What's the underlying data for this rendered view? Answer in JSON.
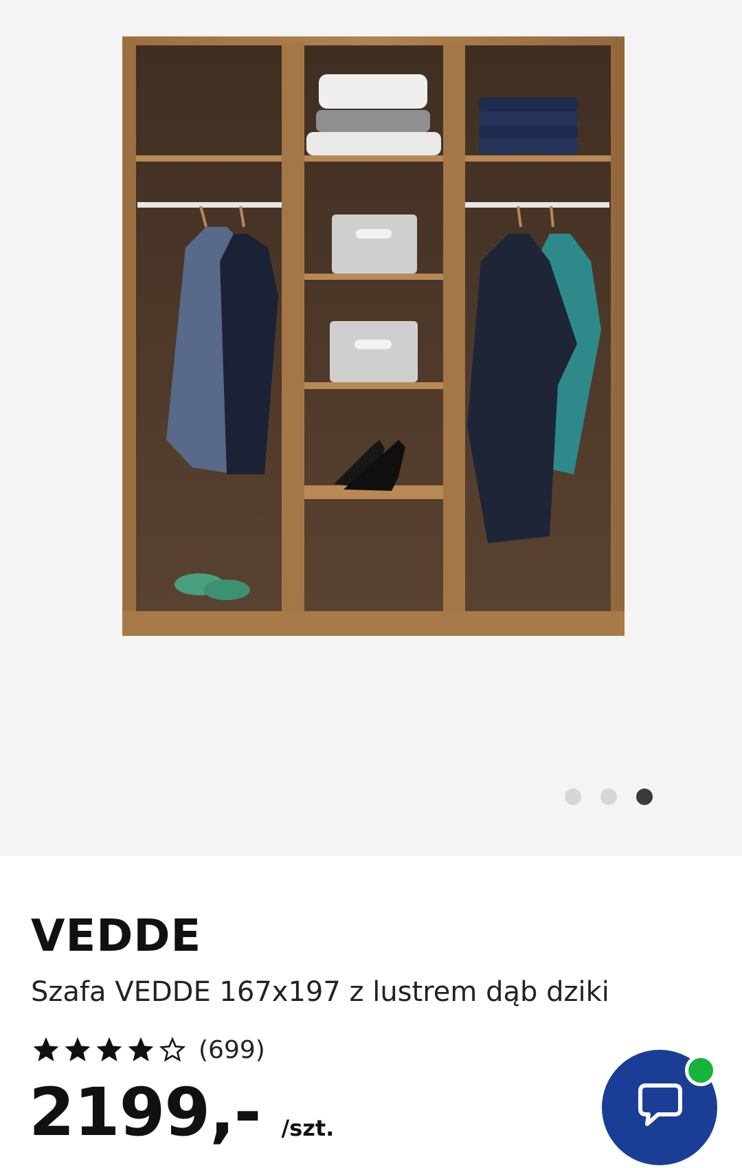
{
  "gallery": {
    "image_alt": "",
    "dots": [
      {
        "active": false
      },
      {
        "active": false
      },
      {
        "active": true
      }
    ]
  },
  "product": {
    "brand": "VEDDE",
    "description": "Szafa VEDDE 167x197 z lustrem dąb dziki",
    "rating": {
      "stars": 4,
      "max": 5,
      "count_label": "(699)"
    },
    "price": "2199,-",
    "unit": "/szt."
  },
  "chat": {
    "icon": "chat-bubble-icon",
    "status": "online"
  },
  "colors": {
    "gallery_bg": "#f4f4f4",
    "chat_blue": "#1a3d95",
    "online_green": "#17b43b",
    "wood": "#a87a4a",
    "wood_dark": "#4e3828"
  }
}
